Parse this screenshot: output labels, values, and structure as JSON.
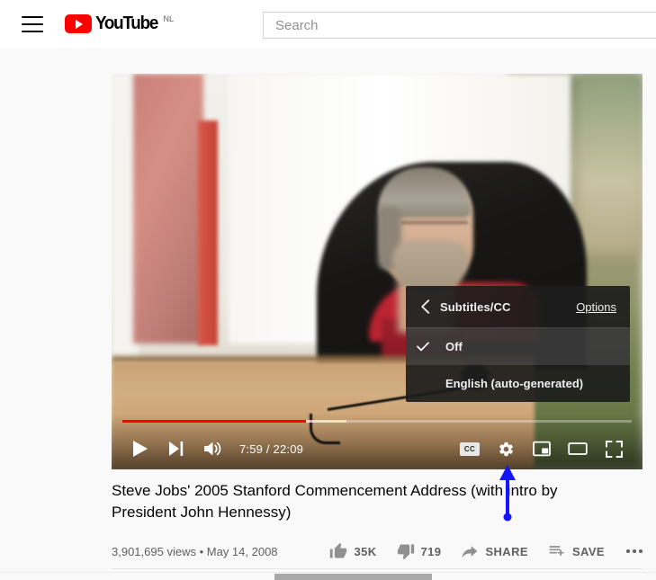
{
  "header": {
    "menu_icon": "hamburger-menu-icon",
    "logo_text": "YouTube",
    "logo_country": "NL",
    "search_placeholder": "Search",
    "search_value": ""
  },
  "player": {
    "settings_menu": {
      "back_icon": "chevron-left-icon",
      "title": "Subtitles/CC",
      "options_label": "Options",
      "items": [
        {
          "label": "Off",
          "selected": true
        },
        {
          "label": "English (auto-generated)",
          "selected": false
        }
      ]
    },
    "controls": {
      "play_icon": "play-icon",
      "next_icon": "next-track-icon",
      "volume_icon": "volume-high-icon",
      "time_display": "7:59 / 22:09",
      "current_time": "7:59",
      "duration": "22:09",
      "progress_percent": 36,
      "buffer_percent": 44,
      "cc_label": "CC",
      "settings_icon": "gear-icon",
      "miniplayer_icon": "miniplayer-icon",
      "theater_icon": "theater-mode-icon",
      "fullscreen_icon": "fullscreen-icon",
      "progress_color": "#ff0000"
    }
  },
  "video": {
    "title": "Steve Jobs' 2005 Stanford Commencement Address (with intro by President John Hennessy)",
    "views": "3,901,695 views",
    "separator": "•",
    "published": "May 14, 2008",
    "likes": "35K",
    "dislikes": "719",
    "share_label": "SHARE",
    "save_label": "SAVE",
    "like_icon": "thumbs-up-icon",
    "dislike_icon": "thumbs-down-icon",
    "share_icon": "share-arrow-icon",
    "save_icon": "playlist-add-icon",
    "more_icon": "more-horizontal-icon"
  },
  "annotation": {
    "arrow_icon": "blue-up-arrow-annotation",
    "color": "#1414ff"
  }
}
